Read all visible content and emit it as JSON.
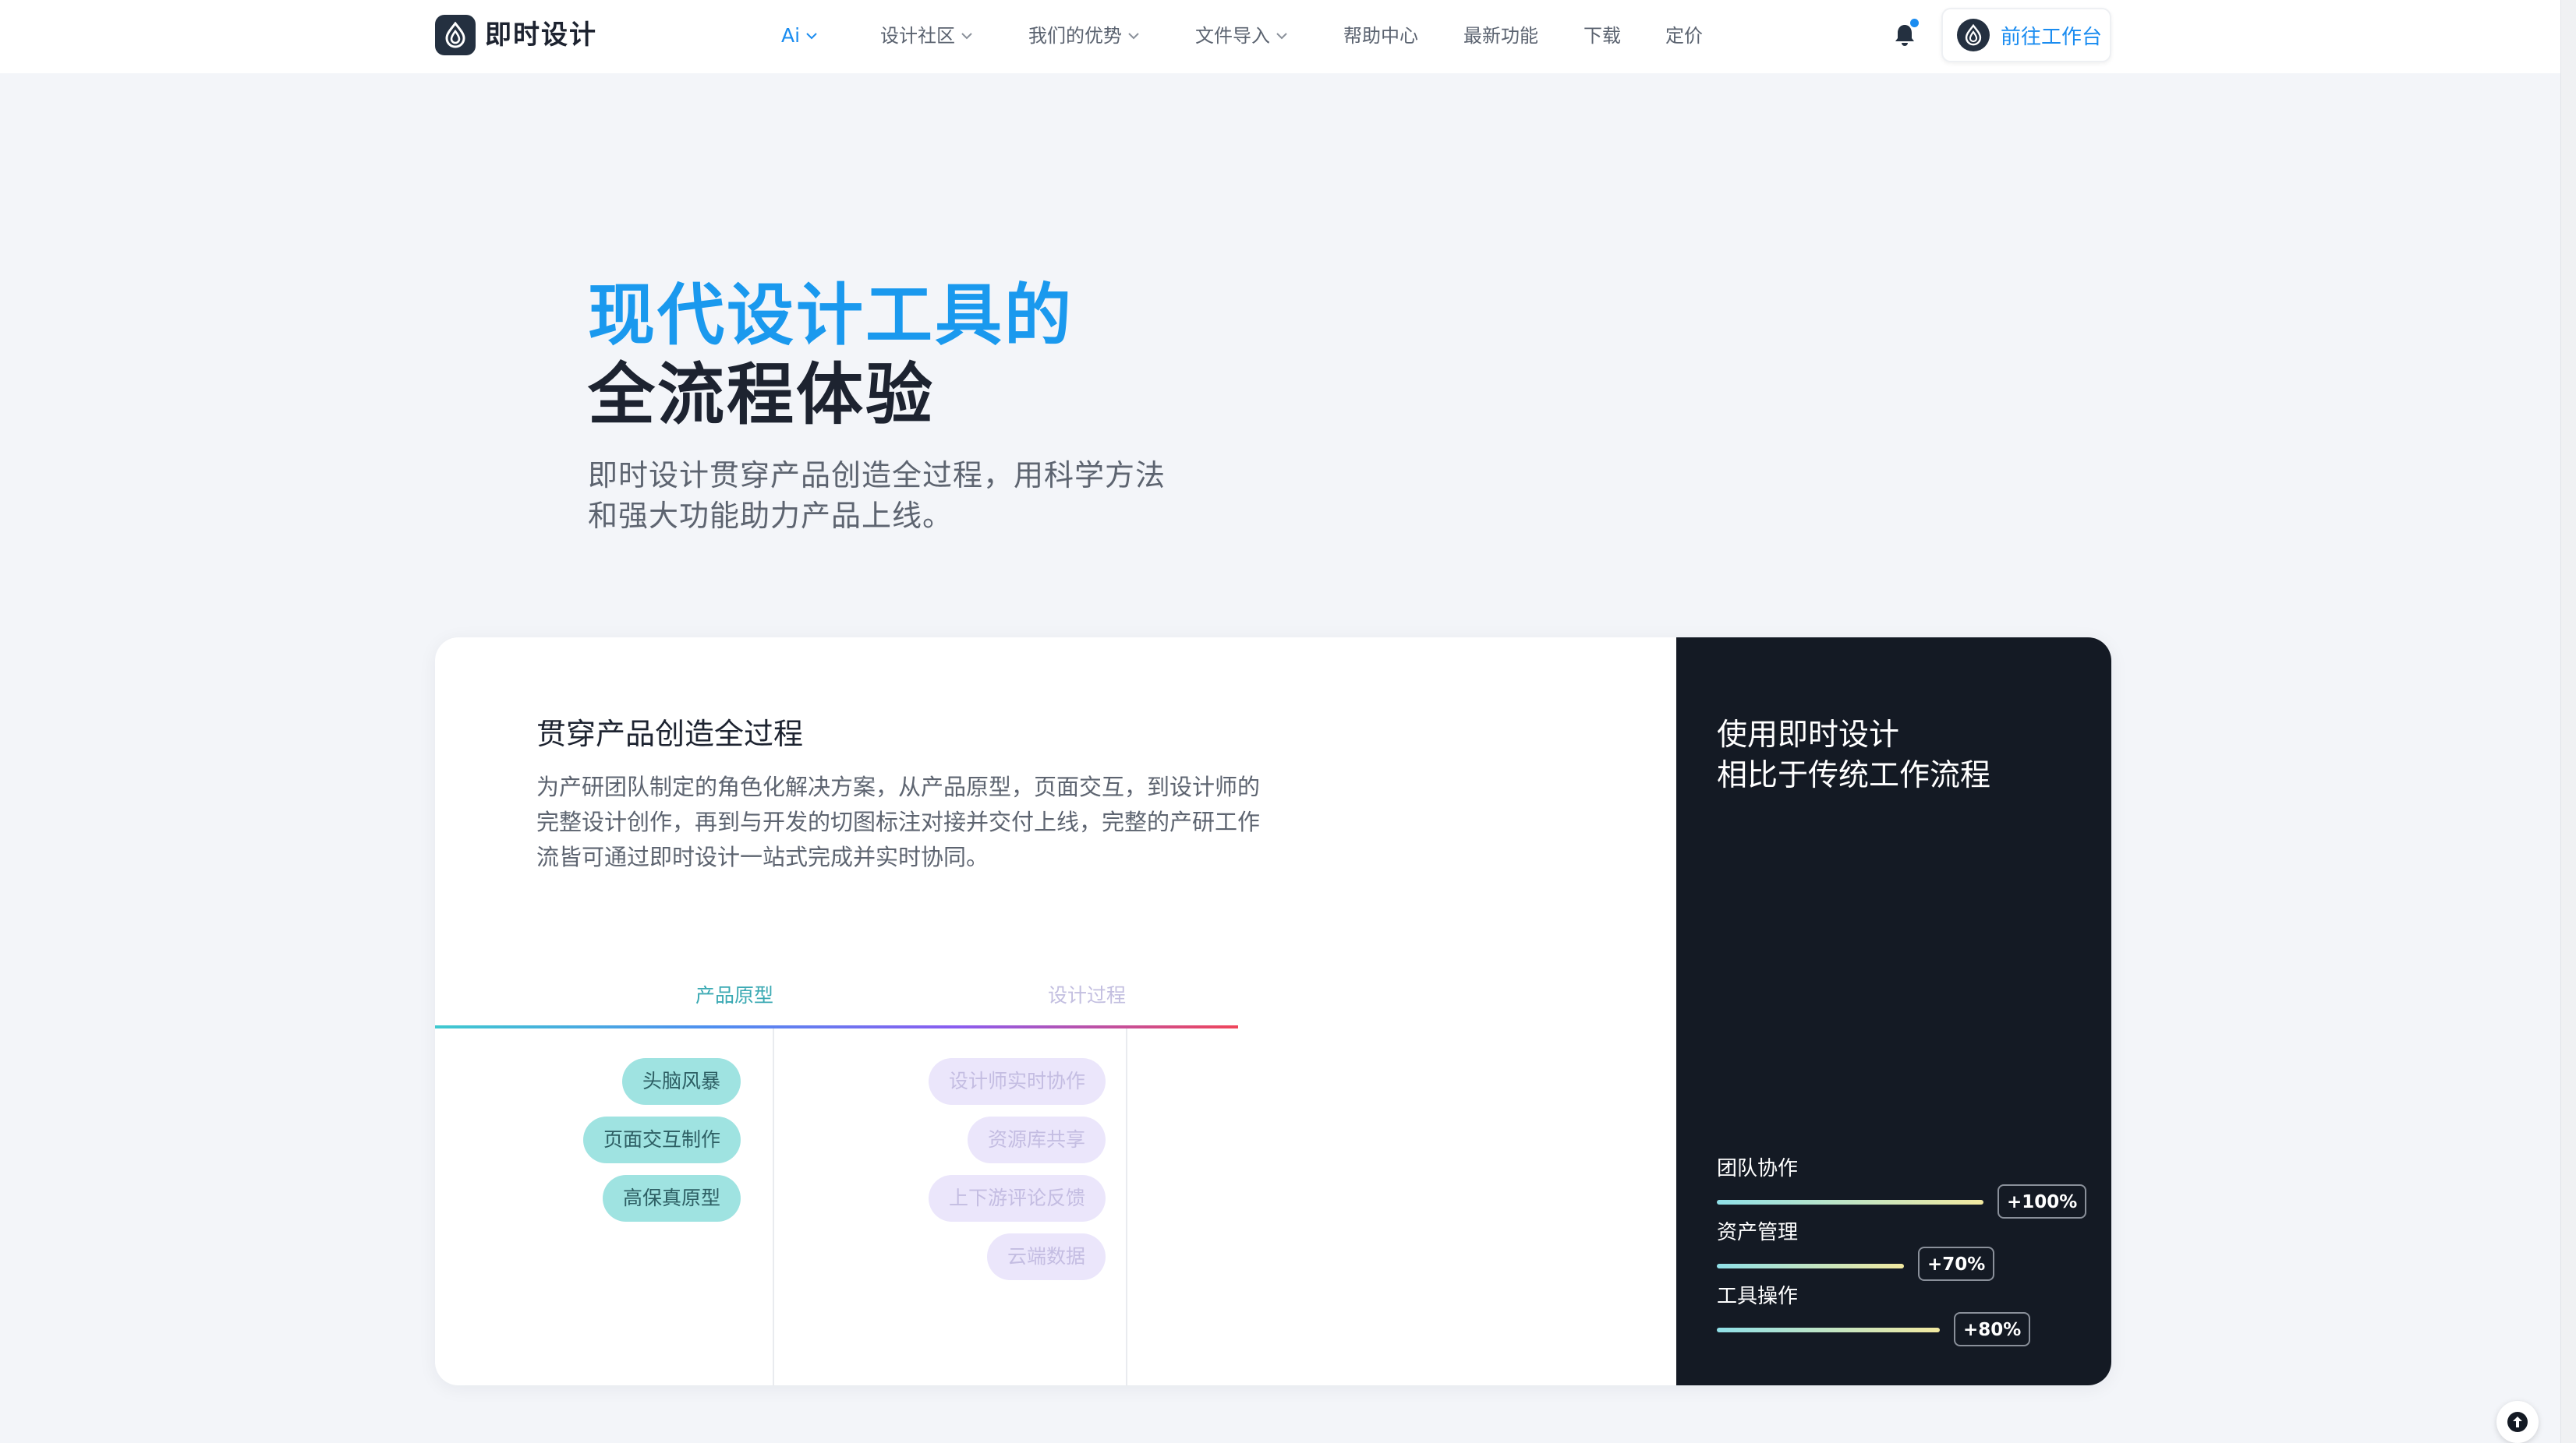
{
  "header": {
    "logo_text": "即时设计",
    "nav": [
      {
        "label": "Ai",
        "has_dropdown": true,
        "active": true
      },
      {
        "label": "设计社区",
        "has_dropdown": true
      },
      {
        "label": "我们的优势",
        "has_dropdown": true
      },
      {
        "label": "文件导入",
        "has_dropdown": true
      },
      {
        "label": "帮助中心",
        "has_dropdown": false
      },
      {
        "label": "最新功能",
        "has_dropdown": false
      },
      {
        "label": "下载",
        "has_dropdown": false
      },
      {
        "label": "定价",
        "has_dropdown": false
      }
    ],
    "notification_icon": "bell-icon",
    "workbench_button": "前往工作台"
  },
  "hero": {
    "title_line1": "现代设计工具的",
    "title_line2": "全流程体验",
    "subtitle": "即时设计贯穿产品创造全过程，用科学方法和强大功能助力产品上线。"
  },
  "feature": {
    "heading": "贯穿产品创造全过程",
    "description": "为产研团队制定的角色化解决方案，从产品原型，页面交互，到设计师的完整设计创作，再到与开发的切图标注对接并交付上线，完整的产研工作流皆可通过即时设计一站式完成并实时协同。",
    "tabs": [
      {
        "label": "产品原型",
        "active": true
      },
      {
        "label": "设计过程",
        "active": false
      }
    ],
    "prototype_items": [
      "头脑风暴",
      "页面交互制作",
      "高保真原型"
    ],
    "design_items": [
      "设计师实时协作",
      "资源库共享",
      "上下游评论反馈",
      "云端数据"
    ]
  },
  "comparison": {
    "heading_line1": "使用即时设计",
    "heading_line2": "相比于传统工作流程",
    "metrics": [
      {
        "label": "团队协作",
        "value": "+100%"
      },
      {
        "label": "资产管理",
        "value": "+70%"
      },
      {
        "label": "工具操作",
        "value": "+80%"
      }
    ]
  },
  "colors": {
    "accent": "#1a8cf0",
    "hero_title": "#1a99ee",
    "dark_panel": "#141a24",
    "pill_teal": "#9fe3e1",
    "pill_lilac": "#ebe6fb"
  },
  "back_to_top_icon": "arrow-up-icon"
}
